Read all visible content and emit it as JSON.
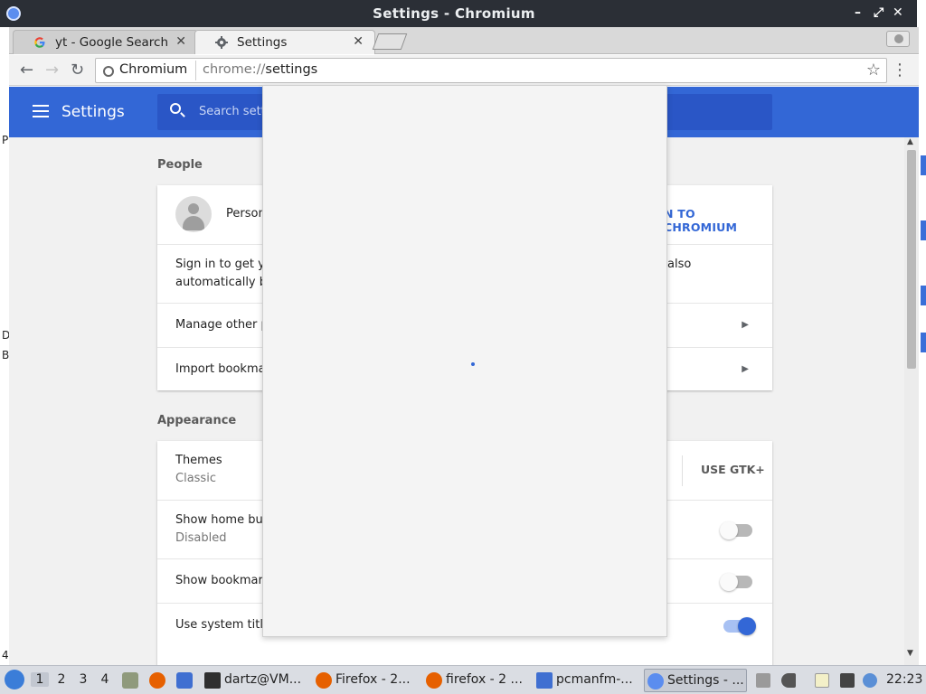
{
  "window": {
    "title": "Settings - Chromium",
    "controls": {
      "minimize": "–",
      "maximize": "⤢",
      "close": "✕"
    }
  },
  "tabs": [
    {
      "label": "yt - Google Search",
      "icon": "google-g-icon",
      "close": "✕",
      "active": false
    },
    {
      "label": "Settings",
      "icon": "gear-icon",
      "close": "✕",
      "active": true
    }
  ],
  "toolbar": {
    "back": "←",
    "forward": "→",
    "reload": "↻",
    "origin": "Chromium",
    "url_scheme": "chrome://",
    "url_path": "settings",
    "star": "☆",
    "menu": "⋮"
  },
  "settings": {
    "header_title": "Settings",
    "search_placeholder": "Search setti",
    "people": {
      "section_title": "People",
      "person_label": "Person",
      "sign_in_button": "N TO CHROMIUM",
      "signin_text_line1": "Sign in to get you",
      "signin_text_line1_tail": "also",
      "signin_text_line2": "automatically be",
      "manage_label": "Manage other pe",
      "import_label": "Import bookmark"
    },
    "appearance": {
      "section_title": "Appearance",
      "themes_label": "Themes",
      "themes_value": "Classic",
      "use_gtk_button": "USE GTK+",
      "home_button_label": "Show home butt",
      "home_button_value": "Disabled",
      "home_button_on": false,
      "bookmarks_label": "Show bookmarks",
      "bookmarks_on": false,
      "system_title_label": "Use system title",
      "system_title_on": true
    }
  },
  "background_window": {
    "fragments": [
      "P",
      "D",
      "B",
      "4"
    ]
  },
  "taskbar": {
    "workspaces": [
      "1",
      "2",
      "3",
      "4"
    ],
    "active_workspace": "1",
    "tasks": [
      {
        "label": "dartz@VM...",
        "icon": "terminal-icon"
      },
      {
        "label": "Firefox - 2...",
        "icon": "firefox-icon"
      },
      {
        "label": "firefox - 2 ...",
        "icon": "firefox-icon"
      },
      {
        "label": "pcmanfm-...",
        "icon": "folder-icon"
      },
      {
        "label": "Settings - ...",
        "icon": "chromium-icon",
        "active": true
      }
    ],
    "clock": "22:23"
  },
  "colors": {
    "accent": "#3367d6",
    "titlebar": "#2b2f36",
    "page_bg": "#f1f1f1"
  }
}
